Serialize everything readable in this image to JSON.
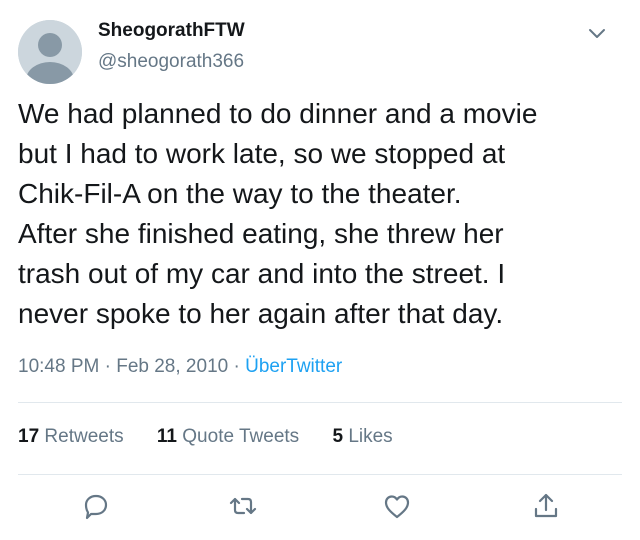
{
  "user": {
    "display_name": "SheogorathFTW",
    "handle": "@sheogorath366"
  },
  "tweet": {
    "text": "We had planned to do dinner and a movie\nbut I had to work late, so we stopped at\nChik-Fil-A on the way to the theater.\nAfter she finished eating, she threw her\ntrash out of my car and into the street. I\nnever spoke to her again after that day."
  },
  "meta": {
    "time": "10:48 PM",
    "separator": " · ",
    "date": "Feb 28, 2010",
    "source": "ÜberTwitter"
  },
  "stats": {
    "retweets_count": "17",
    "retweets_label": "Retweets",
    "quotes_count": "11",
    "quotes_label": "Quote Tweets",
    "likes_count": "5",
    "likes_label": "Likes"
  },
  "icons": {
    "more": "chevron-down-icon",
    "reply": "reply-icon",
    "retweet": "retweet-icon",
    "like": "heart-icon",
    "share": "share-icon"
  },
  "colors": {
    "text": "#14171a",
    "secondary": "#657786",
    "link": "#1da1f2",
    "divider": "#e1e8ed",
    "avatar": "#ccd6dd"
  }
}
